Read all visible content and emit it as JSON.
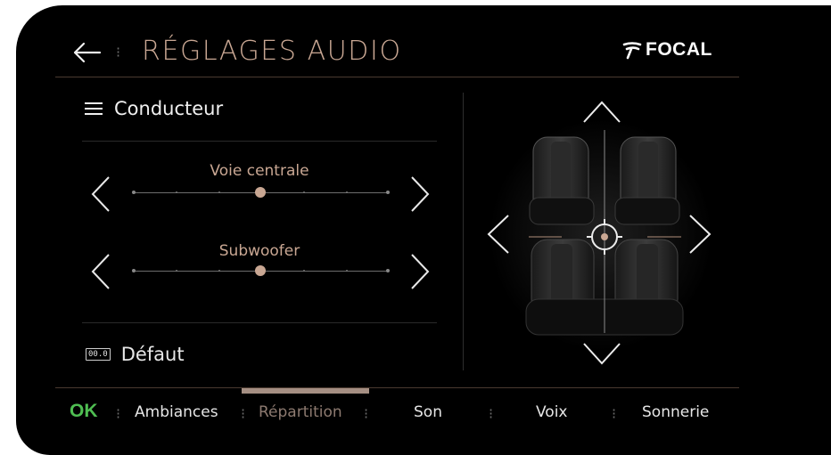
{
  "header": {
    "title": "RÉGLAGES AUDIO",
    "brand": "FOCAL"
  },
  "panel": {
    "profile_label": "Conducteur",
    "sliders": [
      {
        "label": "Voie centrale",
        "value": 0.5
      },
      {
        "label": "Subwoofer",
        "value": 0.5
      }
    ],
    "default_badge": "00.0",
    "default_label": "Défaut"
  },
  "bottom_nav": {
    "ok_label": "OK",
    "items": [
      "Ambiances",
      "Répartition",
      "Son",
      "Voix",
      "Sonnerie"
    ],
    "active_index": 1
  },
  "colors": {
    "accent": "#c9a793",
    "ok": "#4fbe52",
    "active_tab": "#a58f83"
  }
}
